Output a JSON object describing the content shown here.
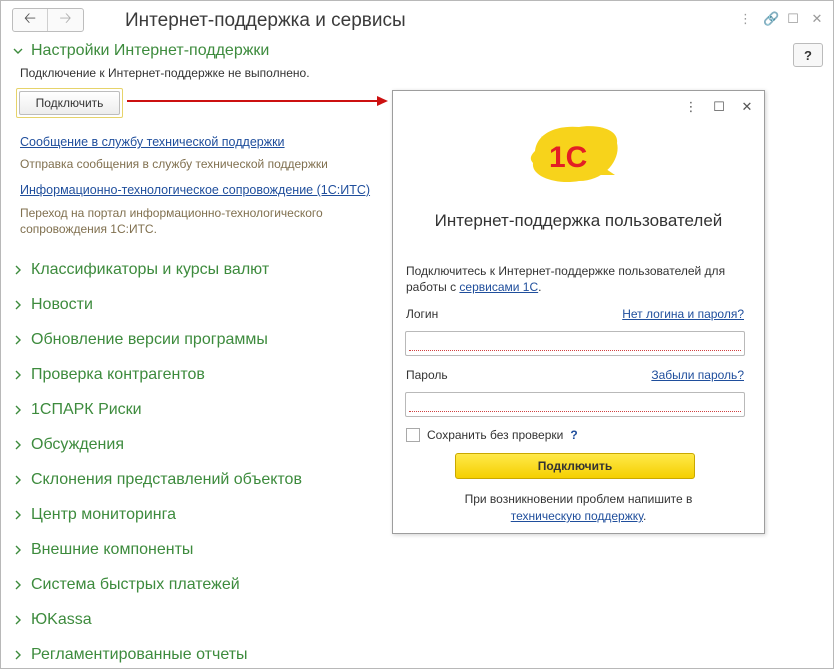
{
  "window": {
    "title": "Интернет-поддержка и сервисы",
    "help_label": "?"
  },
  "support_section": {
    "title": "Настройки Интернет-поддержки",
    "status": "Подключение к Интернет-поддержке не выполнено.",
    "connect_label": "Подключить",
    "links": [
      {
        "label": "Сообщение в службу технической поддержки",
        "desc": "Отправка сообщения в службу технической поддержки"
      },
      {
        "label": "Информационно-технологическое сопровождение (1С:ИТС)",
        "desc": "Переход на портал информационно-технологического сопровождения 1С:ИТС."
      }
    ]
  },
  "sections": [
    {
      "label": "Классификаторы и курсы валют"
    },
    {
      "label": "Новости"
    },
    {
      "label": "Обновление версии программы"
    },
    {
      "label": "Проверка контрагентов"
    },
    {
      "label": "1СПАРК Риски"
    },
    {
      "label": "Обсуждения"
    },
    {
      "label": "Склонения представлений объектов"
    },
    {
      "label": "Центр мониторинга"
    },
    {
      "label": "Внешние компоненты"
    },
    {
      "label": "Система быстрых платежей"
    },
    {
      "label": "ЮKassa"
    },
    {
      "label": "Регламентированные отчеты"
    }
  ],
  "dialog": {
    "logo_text": "1С",
    "title": "Интернет-поддержка пользователей",
    "intro_prefix": "Подключитесь к Интернет-поддержке пользователей для работы с ",
    "intro_link": "сервисами 1С",
    "intro_suffix": ".",
    "login_label": "Логин",
    "login_help": "Нет логина и пароля?",
    "login_value": "",
    "password_label": "Пароль",
    "password_help": "Забыли пароль?",
    "password_value": "",
    "save_label": "Сохранить без проверки",
    "save_help": "?",
    "save_checked": false,
    "connect_label": "Подключить",
    "footer_text": "При возникновении проблем напишите в",
    "footer_link": "техническую поддержку",
    "footer_suffix": "."
  },
  "colors": {
    "section_green": "#3d8b3d",
    "link_blue": "#1f4e9c",
    "arrow_red": "#cc1010",
    "button_yellow": "#f5cf00",
    "logo_red": "#e31e24"
  }
}
